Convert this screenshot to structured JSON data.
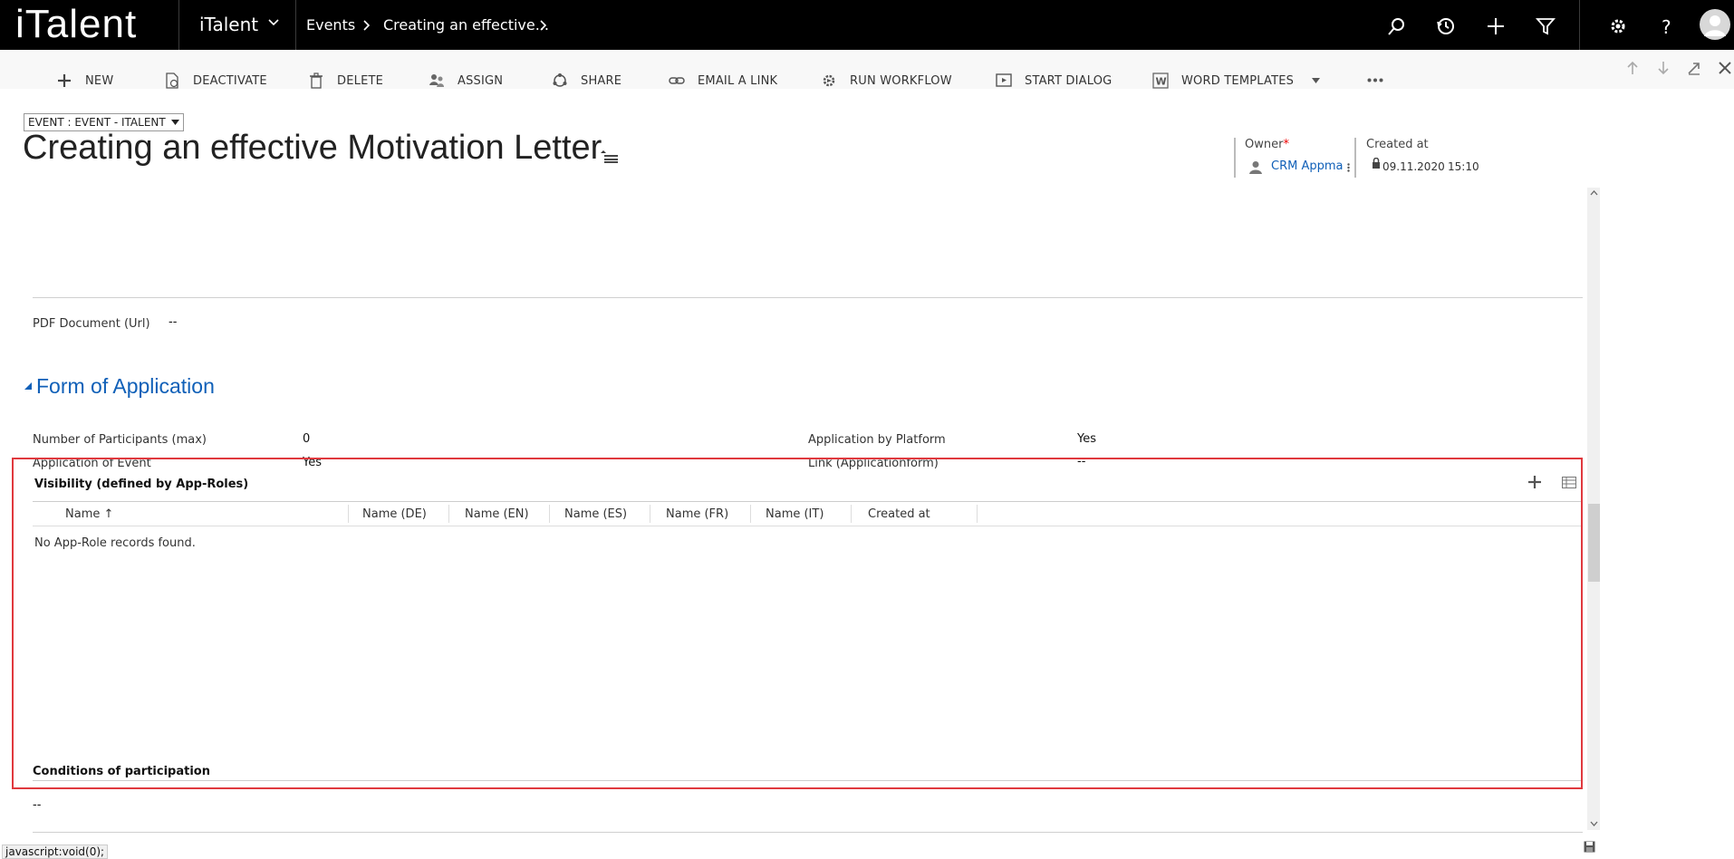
{
  "nav": {
    "logo": "iTalent",
    "app_name": "iTalent",
    "breadcrumbs": [
      "Events",
      "Creating an effective..."
    ]
  },
  "commands": [
    {
      "label": "NEW",
      "icon": "plus-icon"
    },
    {
      "label": "DEACTIVATE",
      "icon": "deactivate-icon"
    },
    {
      "label": "DELETE",
      "icon": "trash-icon"
    },
    {
      "label": "ASSIGN",
      "icon": "assign-icon"
    },
    {
      "label": "SHARE",
      "icon": "share-icon"
    },
    {
      "label": "EMAIL A LINK",
      "icon": "link-icon"
    },
    {
      "label": "RUN WORKFLOW",
      "icon": "workflow-icon"
    },
    {
      "label": "START DIALOG",
      "icon": "dialog-icon"
    },
    {
      "label": "WORD TEMPLATES",
      "icon": "word-icon"
    }
  ],
  "header": {
    "form_selector": "EVENT : EVENT - ITALENT",
    "title": "Creating an effective Motivation Letter",
    "owner_label": "Owner",
    "owner_required": "*",
    "owner_value": "CRM Appma",
    "created_label": "Created at",
    "created_date": "09.11.2020",
    "created_time": "15:10"
  },
  "fields": {
    "pdf_label": "PDF Document (Url)",
    "pdf_value": "--",
    "section_title": "Form of Application",
    "participants_label": "Number of Participants (max)",
    "participants_value": "0",
    "app_platform_label": "Application by Platform",
    "app_platform_value": "Yes",
    "app_event_label": "Application of Event",
    "app_event_value": "Yes",
    "link_label": "Link (Applicationform)",
    "link_value": "--"
  },
  "subgrid": {
    "title": "Visibility (defined by App-Roles)",
    "columns": [
      "Name",
      "Name (DE)",
      "Name (EN)",
      "Name (ES)",
      "Name (FR)",
      "Name (IT)",
      "Created at"
    ],
    "sort_arrow": "↑",
    "empty_message": "No App-Role records found."
  },
  "conditions": {
    "title": "Conditions of participation",
    "value": "--"
  },
  "status": {
    "text": "javascript:void(0);"
  }
}
